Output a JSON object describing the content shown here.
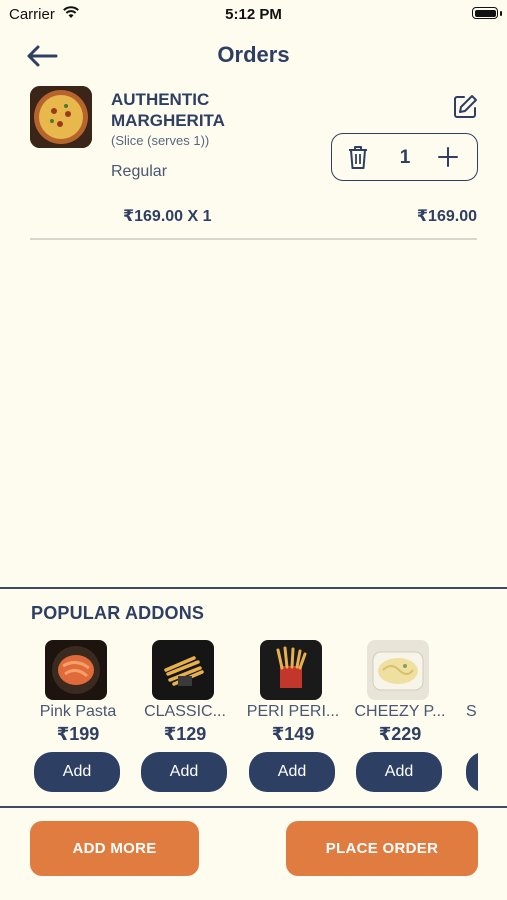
{
  "status_bar": {
    "carrier": "Carrier",
    "time": "5:12 PM"
  },
  "header": {
    "title": "Orders"
  },
  "order_item": {
    "name": "AUTHENTIC MARGHERITA",
    "subtitle": "(Slice (serves 1))",
    "variant": "Regular",
    "quantity": "1",
    "unit_line": "₹169.00 X 1",
    "line_total": "₹169.00"
  },
  "addons": {
    "title": "POPULAR ADDONS",
    "items": [
      {
        "name": "Pink Pasta",
        "price": "₹199",
        "button": "Add"
      },
      {
        "name": "CLASSIC...",
        "price": "₹129",
        "button": "Add"
      },
      {
        "name": "PERI PERI...",
        "price": "₹149",
        "button": "Add"
      },
      {
        "name": "CHEEZY P...",
        "price": "₹229",
        "button": "Add"
      },
      {
        "name": "S"
      }
    ]
  },
  "footer": {
    "add_more": "ADD MORE",
    "place_order": "PLACE ORDER"
  },
  "colors": {
    "background": "#fdfcee",
    "primary": "#2f3f63",
    "accent": "#e07c40"
  }
}
